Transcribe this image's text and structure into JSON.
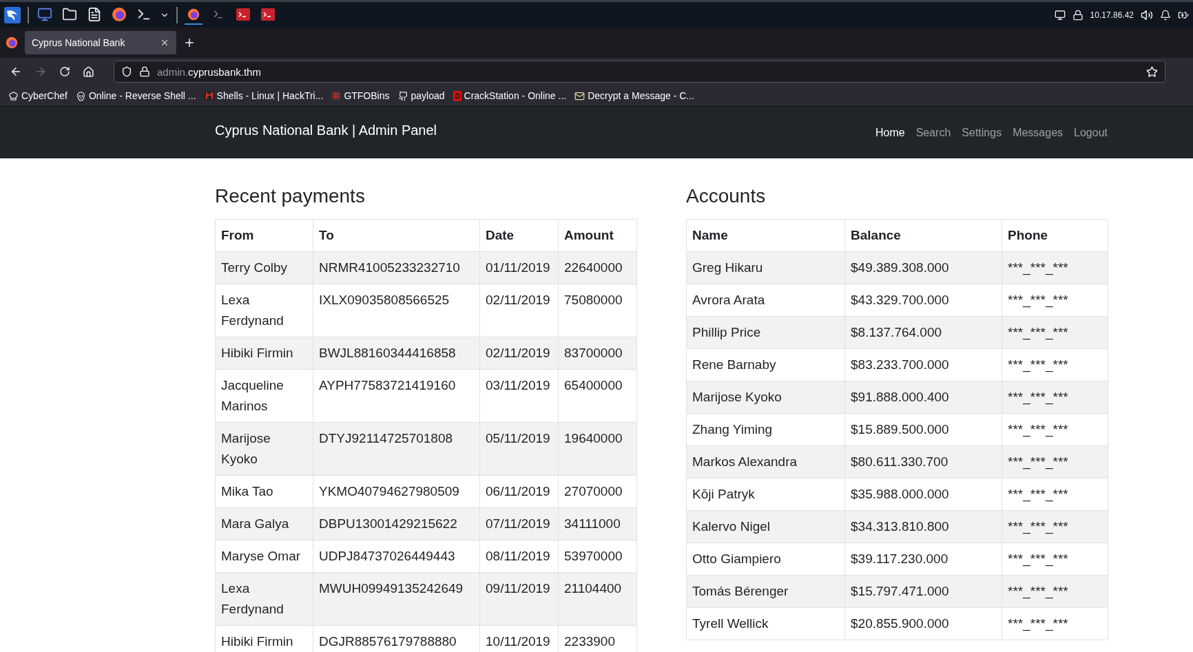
{
  "taskbar": {
    "ip": "10.17.86.42"
  },
  "browser": {
    "tab_title": "Cyprus National Bank",
    "url_prefix": "admin.",
    "url_host": "cyprusbank.thm",
    "bookmarks": [
      {
        "kind": "chef",
        "label": "CyberChef"
      },
      {
        "kind": "skull",
        "label": "Online - Reverse Shell ..."
      },
      {
        "kind": "shells",
        "label": "Shells - Linux | HackTri..."
      },
      {
        "kind": "gtfo",
        "label": "GTFOBins"
      },
      {
        "kind": "github",
        "label": "payload"
      },
      {
        "kind": "crack",
        "label": "CrackStation - Online ..."
      },
      {
        "kind": "mail",
        "label": "Decrypt a Message - C..."
      }
    ]
  },
  "navbar": {
    "brand": "Cyprus National Bank | Admin Panel",
    "links": [
      {
        "label": "Home",
        "selected": true
      },
      {
        "label": "Search",
        "selected": false
      },
      {
        "label": "Settings",
        "selected": false
      },
      {
        "label": "Messages",
        "selected": false
      },
      {
        "label": "Logout",
        "selected": false
      }
    ]
  },
  "payments": {
    "title": "Recent payments",
    "columns": [
      "From",
      "To",
      "Date",
      "Amount"
    ],
    "rows": [
      [
        "Terry Colby",
        "NRMR41005233232710",
        "01/11/2019",
        "22640000"
      ],
      [
        "Lexa Ferdynand",
        "IXLX09035808566525",
        "02/11/2019",
        "75080000"
      ],
      [
        "Hibiki Firmin",
        "BWJL88160344416858",
        "02/11/2019",
        "83700000"
      ],
      [
        "Jacqueline Marinos",
        "AYPH77583721419160",
        "03/11/2019",
        "65400000"
      ],
      [
        "Marijose Kyoko",
        "DTYJ92114725701808",
        "05/11/2019",
        "19640000"
      ],
      [
        "Mika Tao",
        "YKMO40794627980509",
        "06/11/2019",
        "27070000"
      ],
      [
        "Mara Galya",
        "DBPU13001429215622",
        "07/11/2019",
        "34111000"
      ],
      [
        "Maryse Omar",
        "UDPJ84737026449443",
        "08/11/2019",
        "53970000"
      ],
      [
        "Lexa Ferdynand",
        "MWUH09949135242649",
        "09/11/2019",
        "21104400"
      ],
      [
        "Hibiki Firmin",
        "DGJR88576179788880",
        "10/11/2019",
        "2233900"
      ]
    ]
  },
  "accounts": {
    "title": "Accounts",
    "columns": [
      "Name",
      "Balance",
      "Phone"
    ],
    "rows": [
      [
        "Greg Hikaru",
        "$49.389.308.000",
        "***_***_***"
      ],
      [
        "Avrora Arata",
        "$43.329.700.000",
        "***_***_***"
      ],
      [
        "Phillip Price",
        "$8.137.764.000",
        "***_***_***"
      ],
      [
        "Rene Barnaby",
        "$83.233.700.000",
        "***_***_***"
      ],
      [
        "Marijose Kyoko",
        "$91.888.000.400",
        "***_***_***"
      ],
      [
        "Zhang Yiming",
        "$15.889.500.000",
        "***_***_***"
      ],
      [
        "Markos Alexandra",
        "$80.611.330.700",
        "***_***_***"
      ],
      [
        "Kōji Patryk",
        "$35.988.000.000",
        "***_***_***"
      ],
      [
        "Kalervo Nigel",
        "$34.313.810.800",
        "***_***_***"
      ],
      [
        "Otto Giampiero",
        "$39.117.230.000",
        "***_***_***"
      ],
      [
        "Tomás Bérenger",
        "$15.797.471.000",
        "***_***_***"
      ],
      [
        "Tyrell Wellick",
        "$20.855.900.000",
        "***_***_***"
      ]
    ]
  }
}
